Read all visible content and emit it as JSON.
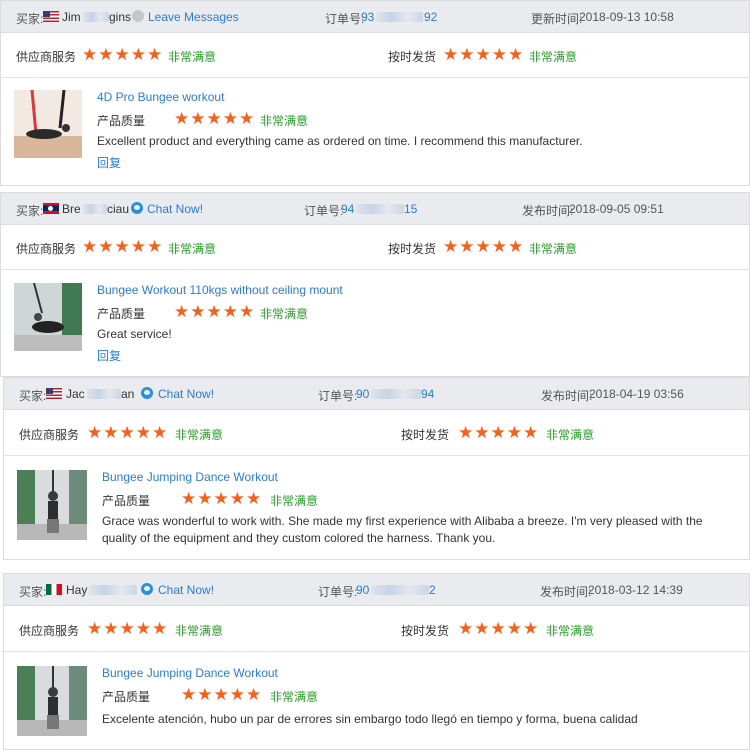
{
  "labels": {
    "buyer": "买家:",
    "order": "订单号:",
    "updated": "更新时间:",
    "published": "发布时间:",
    "supplier_service": "供应商服务",
    "on_time_delivery": "按时发货",
    "product_quality": "产品质量",
    "very_satisfied": "非常满意",
    "reply": "回复",
    "leave_messages": "Leave Messages",
    "chat_now": "Chat Now!"
  },
  "stars_glyph": "★★★★★",
  "star_color": "#f5611c",
  "reviews": [
    {
      "buyer_name_start": "Jim",
      "buyer_name_end": "gins",
      "flag": "us-flag",
      "contact_label": "Leave Messages",
      "order_start": "93",
      "order_end": "92",
      "time_label": "更新时间:",
      "time": "2018-09-13 10:58",
      "product_title": "4D Pro Bungee workout",
      "comment": "Excellent product and everything came as ordered on time. I recommend this manufacturer.",
      "show_reply": true
    },
    {
      "buyer_name_start": "Bre",
      "buyer_name_end": "ciau",
      "flag": "laos-flag",
      "contact_label": "Chat Now!",
      "order_start": "94",
      "order_end": "15",
      "time_label": "发布时间:",
      "time": "2018-09-05 09:51",
      "product_title": "Bungee Workout 110kgs without ceiling mount",
      "comment": "Great service!",
      "show_reply": true
    },
    {
      "buyer_name_start": "Jac",
      "buyer_name_end": "an",
      "flag": "us-flag",
      "contact_label": "Chat Now!",
      "order_start": "90",
      "order_end": "94",
      "time_label": "发布时间:",
      "time": "2018-04-19 03:56",
      "product_title": "Bungee Jumping Dance Workout",
      "comment": "Grace was wonderful to work with. She made my first experience with Alibaba a breeze. I'm very pleased with the quality of the equipment and they custom colored the harness. Thank you.",
      "show_reply": false
    },
    {
      "buyer_name_start": "Hay",
      "buyer_name_end": "",
      "flag": "mexico-flag",
      "contact_label": "Chat Now!",
      "order_start": "90",
      "order_end": "2",
      "time_label": "发布时间:",
      "time": "2018-03-12 14:39",
      "product_title": "Bungee Jumping Dance Workout",
      "comment": "Excelente atención, hubo un par de errores sin embargo todo llegó en tiempo y forma, buena calidad",
      "show_reply": false
    }
  ]
}
